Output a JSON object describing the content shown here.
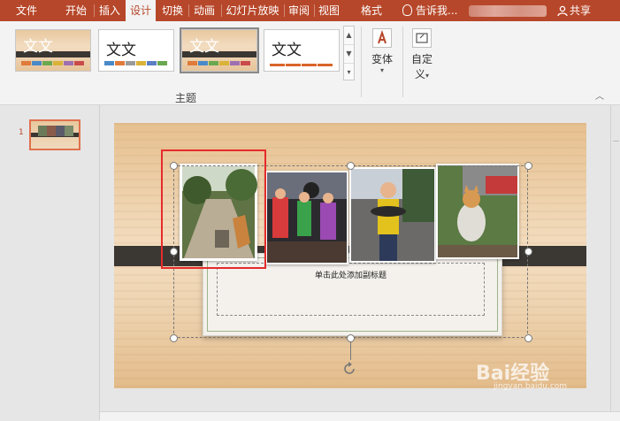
{
  "tabs": [
    {
      "id": "file",
      "label": "文件",
      "active": false
    },
    {
      "id": "home",
      "label": "开始",
      "active": false
    },
    {
      "id": "insert",
      "label": "插入",
      "active": false
    },
    {
      "id": "design",
      "label": "设计",
      "active": true
    },
    {
      "id": "transitions",
      "label": "切换",
      "active": false
    },
    {
      "id": "animations",
      "label": "动画",
      "active": false
    },
    {
      "id": "slideshow",
      "label": "幻灯片放映",
      "active": false
    },
    {
      "id": "review",
      "label": "审阅",
      "active": false
    },
    {
      "id": "view",
      "label": "视图",
      "active": false
    },
    {
      "id": "format",
      "label": "格式",
      "active": false
    }
  ],
  "tell_me": {
    "label": "告诉我..."
  },
  "share": {
    "label": "共享"
  },
  "ribbon": {
    "themes": [
      {
        "label": "文文",
        "style": "wood",
        "selected": false
      },
      {
        "label": "文文",
        "style": "white",
        "selected": false
      },
      {
        "label": "文文",
        "style": "wood",
        "selected": true
      },
      {
        "label": "文文",
        "style": "white",
        "selected": false
      }
    ],
    "theme_colors": [
      "#e07a3a",
      "#4a8ac9",
      "#6aa84f",
      "#d9b238",
      "#9e6fb0",
      "#c94a4a"
    ],
    "variants": {
      "label": "变体"
    },
    "customize": {
      "label": "自定",
      "label2": "义"
    },
    "group_label": "主题"
  },
  "slide_panel": {
    "slide_number": "1"
  },
  "slide": {
    "subtitle_placeholder": "单击此处添加副标题"
  },
  "colors": {
    "accent": "#b7472a",
    "selection_red": "#e52b2b"
  },
  "watermark": {
    "text": "Bai经验",
    "url": "jingyan.baidu.com"
  }
}
